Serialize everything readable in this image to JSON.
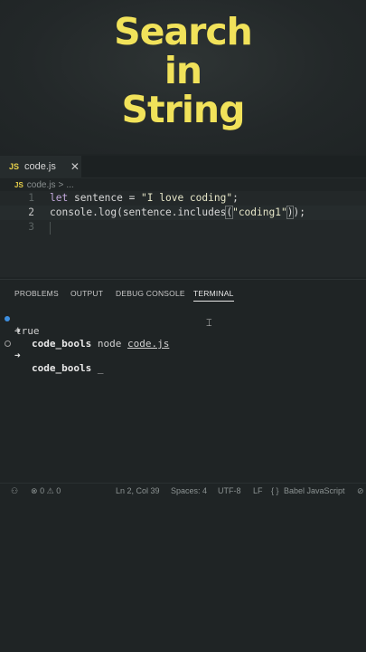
{
  "banner": {
    "line1": "Search",
    "line2": "in",
    "line3": "String"
  },
  "editor": {
    "tab": {
      "badge": "JS",
      "filename": "code.js",
      "close": "✕"
    },
    "breadcrumb": {
      "badge": "JS",
      "filename": "code.js",
      "sep": ">",
      "rest": "..."
    },
    "lines": [
      {
        "num": "1"
      },
      {
        "num": "2"
      },
      {
        "num": "3"
      }
    ],
    "code": {
      "l1_kw": "let",
      "l1_rest": " sentence = ",
      "l1_str": "\"I love coding\"",
      "l1_end": ";",
      "l2_a": "console.log(sentence.includes",
      "l2_open": "(",
      "l2_str": "\"coding1\"",
      "l2_close": ")",
      "l2_end": ");"
    }
  },
  "panel": {
    "tabs": [
      "PROBLEMS",
      "OUTPUT",
      "DEBUG CONSOLE",
      "TERMINAL"
    ],
    "active_tab": "TERMINAL"
  },
  "terminal": {
    "prompt_arrow": "➜",
    "dir": "code_bools",
    "command": "node",
    "arg": "code.js",
    "output": "true",
    "cursor": "_"
  },
  "statusbar": {
    "errors": "0",
    "warnings": "0",
    "position": "Ln 2, Col 39",
    "spaces": "Spaces: 4",
    "encoding": "UTF-8",
    "eol": "LF",
    "braces": "{ }",
    "language": "Babel JavaScript"
  },
  "colors": {
    "title": "#f1e25a",
    "background": "#1f2425",
    "terminal_dot": "#3d8fe0"
  }
}
